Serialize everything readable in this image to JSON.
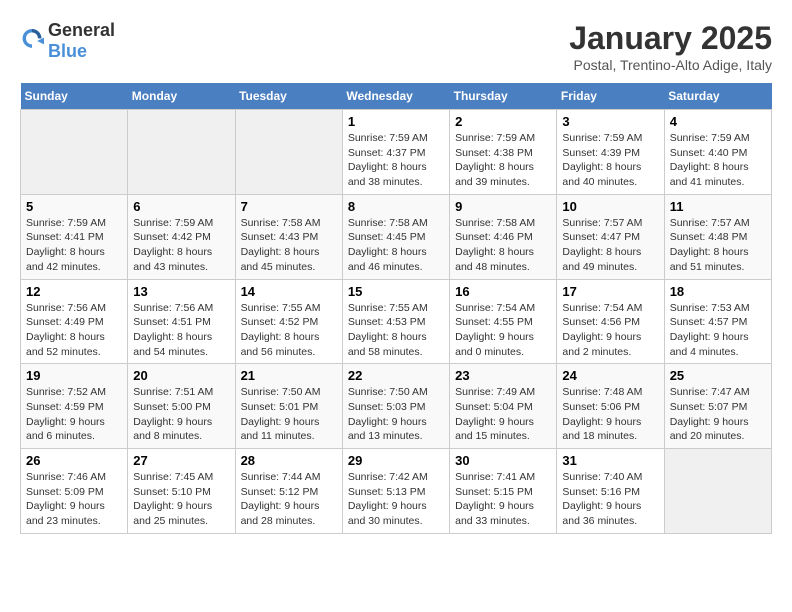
{
  "header": {
    "logo_general": "General",
    "logo_blue": "Blue",
    "title": "January 2025",
    "subtitle": "Postal, Trentino-Alto Adige, Italy"
  },
  "days_of_week": [
    "Sunday",
    "Monday",
    "Tuesday",
    "Wednesday",
    "Thursday",
    "Friday",
    "Saturday"
  ],
  "weeks": [
    [
      {
        "day": "",
        "info": ""
      },
      {
        "day": "",
        "info": ""
      },
      {
        "day": "",
        "info": ""
      },
      {
        "day": "1",
        "info": "Sunrise: 7:59 AM\nSunset: 4:37 PM\nDaylight: 8 hours and 38 minutes."
      },
      {
        "day": "2",
        "info": "Sunrise: 7:59 AM\nSunset: 4:38 PM\nDaylight: 8 hours and 39 minutes."
      },
      {
        "day": "3",
        "info": "Sunrise: 7:59 AM\nSunset: 4:39 PM\nDaylight: 8 hours and 40 minutes."
      },
      {
        "day": "4",
        "info": "Sunrise: 7:59 AM\nSunset: 4:40 PM\nDaylight: 8 hours and 41 minutes."
      }
    ],
    [
      {
        "day": "5",
        "info": "Sunrise: 7:59 AM\nSunset: 4:41 PM\nDaylight: 8 hours and 42 minutes."
      },
      {
        "day": "6",
        "info": "Sunrise: 7:59 AM\nSunset: 4:42 PM\nDaylight: 8 hours and 43 minutes."
      },
      {
        "day": "7",
        "info": "Sunrise: 7:58 AM\nSunset: 4:43 PM\nDaylight: 8 hours and 45 minutes."
      },
      {
        "day": "8",
        "info": "Sunrise: 7:58 AM\nSunset: 4:45 PM\nDaylight: 8 hours and 46 minutes."
      },
      {
        "day": "9",
        "info": "Sunrise: 7:58 AM\nSunset: 4:46 PM\nDaylight: 8 hours and 48 minutes."
      },
      {
        "day": "10",
        "info": "Sunrise: 7:57 AM\nSunset: 4:47 PM\nDaylight: 8 hours and 49 minutes."
      },
      {
        "day": "11",
        "info": "Sunrise: 7:57 AM\nSunset: 4:48 PM\nDaylight: 8 hours and 51 minutes."
      }
    ],
    [
      {
        "day": "12",
        "info": "Sunrise: 7:56 AM\nSunset: 4:49 PM\nDaylight: 8 hours and 52 minutes."
      },
      {
        "day": "13",
        "info": "Sunrise: 7:56 AM\nSunset: 4:51 PM\nDaylight: 8 hours and 54 minutes."
      },
      {
        "day": "14",
        "info": "Sunrise: 7:55 AM\nSunset: 4:52 PM\nDaylight: 8 hours and 56 minutes."
      },
      {
        "day": "15",
        "info": "Sunrise: 7:55 AM\nSunset: 4:53 PM\nDaylight: 8 hours and 58 minutes."
      },
      {
        "day": "16",
        "info": "Sunrise: 7:54 AM\nSunset: 4:55 PM\nDaylight: 9 hours and 0 minutes."
      },
      {
        "day": "17",
        "info": "Sunrise: 7:54 AM\nSunset: 4:56 PM\nDaylight: 9 hours and 2 minutes."
      },
      {
        "day": "18",
        "info": "Sunrise: 7:53 AM\nSunset: 4:57 PM\nDaylight: 9 hours and 4 minutes."
      }
    ],
    [
      {
        "day": "19",
        "info": "Sunrise: 7:52 AM\nSunset: 4:59 PM\nDaylight: 9 hours and 6 minutes."
      },
      {
        "day": "20",
        "info": "Sunrise: 7:51 AM\nSunset: 5:00 PM\nDaylight: 9 hours and 8 minutes."
      },
      {
        "day": "21",
        "info": "Sunrise: 7:50 AM\nSunset: 5:01 PM\nDaylight: 9 hours and 11 minutes."
      },
      {
        "day": "22",
        "info": "Sunrise: 7:50 AM\nSunset: 5:03 PM\nDaylight: 9 hours and 13 minutes."
      },
      {
        "day": "23",
        "info": "Sunrise: 7:49 AM\nSunset: 5:04 PM\nDaylight: 9 hours and 15 minutes."
      },
      {
        "day": "24",
        "info": "Sunrise: 7:48 AM\nSunset: 5:06 PM\nDaylight: 9 hours and 18 minutes."
      },
      {
        "day": "25",
        "info": "Sunrise: 7:47 AM\nSunset: 5:07 PM\nDaylight: 9 hours and 20 minutes."
      }
    ],
    [
      {
        "day": "26",
        "info": "Sunrise: 7:46 AM\nSunset: 5:09 PM\nDaylight: 9 hours and 23 minutes."
      },
      {
        "day": "27",
        "info": "Sunrise: 7:45 AM\nSunset: 5:10 PM\nDaylight: 9 hours and 25 minutes."
      },
      {
        "day": "28",
        "info": "Sunrise: 7:44 AM\nSunset: 5:12 PM\nDaylight: 9 hours and 28 minutes."
      },
      {
        "day": "29",
        "info": "Sunrise: 7:42 AM\nSunset: 5:13 PM\nDaylight: 9 hours and 30 minutes."
      },
      {
        "day": "30",
        "info": "Sunrise: 7:41 AM\nSunset: 5:15 PM\nDaylight: 9 hours and 33 minutes."
      },
      {
        "day": "31",
        "info": "Sunrise: 7:40 AM\nSunset: 5:16 PM\nDaylight: 9 hours and 36 minutes."
      },
      {
        "day": "",
        "info": ""
      }
    ]
  ]
}
